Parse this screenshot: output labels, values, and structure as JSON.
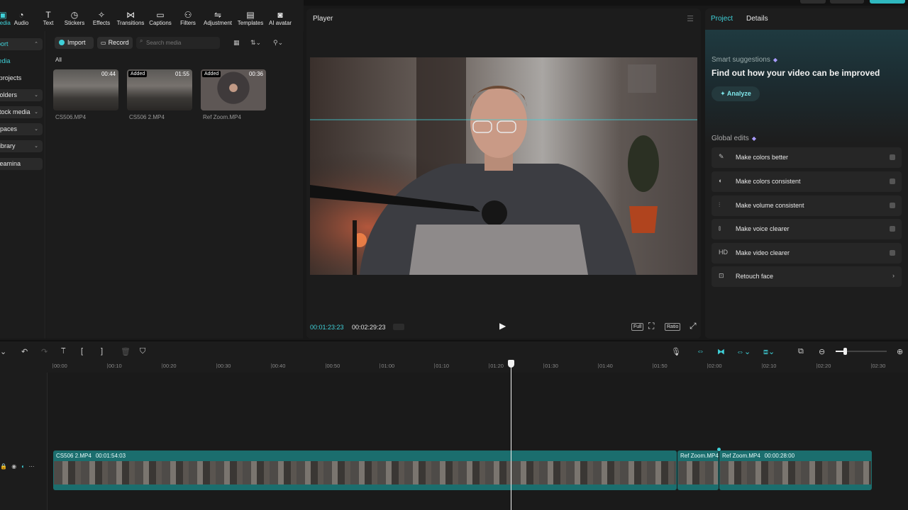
{
  "toolbar": {
    "items": [
      {
        "label": "Media",
        "icon": "media-icon",
        "glyph": "▣"
      },
      {
        "label": "Audio",
        "icon": "audio-icon",
        "glyph": "◔"
      },
      {
        "label": "Text",
        "icon": "text-icon",
        "glyph": "T"
      },
      {
        "label": "Stickers",
        "icon": "stickers-icon",
        "glyph": "◷"
      },
      {
        "label": "Effects",
        "icon": "effects-icon",
        "glyph": "✧"
      },
      {
        "label": "Transitions",
        "icon": "transitions-icon",
        "glyph": "⋈"
      },
      {
        "label": "Captions",
        "icon": "captions-icon",
        "glyph": "▭"
      },
      {
        "label": "Filters",
        "icon": "filters-icon",
        "glyph": "⚇"
      },
      {
        "label": "Adjustment",
        "icon": "adjustment-icon",
        "glyph": "⇋"
      },
      {
        "label": "Templates",
        "icon": "templates-icon",
        "glyph": "▤"
      },
      {
        "label": "AI avatar",
        "icon": "ai-avatar-icon",
        "glyph": "◙"
      }
    ]
  },
  "leftnav": {
    "items": [
      {
        "label": "Import",
        "chev": "⌃",
        "boxed": true,
        "active": true
      },
      {
        "label": "Media",
        "chev": "",
        "boxed": false,
        "active": true
      },
      {
        "label": "Your projects",
        "chev": "",
        "boxed": false,
        "active": false
      },
      {
        "label": "Folders",
        "chev": "⌄",
        "boxed": true,
        "active": false
      },
      {
        "label": "Stock media",
        "chev": "⌄",
        "boxed": true,
        "active": false
      },
      {
        "label": "Spaces",
        "chev": "⌄",
        "boxed": true,
        "active": false
      },
      {
        "label": "Library",
        "chev": "⌄",
        "boxed": true,
        "active": false
      },
      {
        "label": "Dreamina",
        "chev": "",
        "boxed": true,
        "active": false
      }
    ]
  },
  "media": {
    "import_label": "Import",
    "record_label": "Record",
    "search_placeholder": "Search media",
    "all_label": "All",
    "clips": [
      {
        "name": "CS506.MP4",
        "duration": "00:44",
        "added": ""
      },
      {
        "name": "CS506 2.MP4",
        "duration": "01:55",
        "added": "Added"
      },
      {
        "name": "Ref Zoom.MP4",
        "duration": "00:36",
        "added": "Added"
      }
    ]
  },
  "player": {
    "title": "Player",
    "current_time": "00:01:23:23",
    "total_time": "00:02:29:23",
    "full_label": "Full",
    "ratio_label": "Ratio"
  },
  "right_panel": {
    "tab_project": "Project",
    "tab_details": "Details",
    "smart_title": "Smart suggestions",
    "smart_headline": "Find out how your video can be improved",
    "analyze_label": "Analyze",
    "global_title": "Global edits",
    "global_items": [
      {
        "label": "Make colors better",
        "icon": "magic-wand-icon",
        "glyph": "✎",
        "kind": "toggle"
      },
      {
        "label": "Make colors consistent",
        "icon": "palette-icon",
        "glyph": "◐",
        "kind": "toggle"
      },
      {
        "label": "Make volume consistent",
        "icon": "sliders-icon",
        "glyph": "⫶",
        "kind": "toggle"
      },
      {
        "label": "Make voice clearer",
        "icon": "waveform-icon",
        "glyph": "⫾",
        "kind": "toggle"
      },
      {
        "label": "Make video clearer",
        "icon": "hd-icon",
        "glyph": "HD",
        "kind": "toggle"
      },
      {
        "label": "Retouch face",
        "icon": "retouch-icon",
        "glyph": "⊡",
        "kind": "chevron"
      }
    ]
  },
  "timeline": {
    "ruler_labels": [
      "00:00",
      "00:10",
      "00:20",
      "00:30",
      "00:40",
      "00:50",
      "01:00",
      "01:10",
      "01:20",
      "01:30",
      "01:40",
      "01:50",
      "02:00",
      "02:10",
      "02:20",
      "02:30"
    ],
    "clips": [
      {
        "name": "CS506 2.MP4",
        "duration": "00:01:54:03"
      },
      {
        "name": "Ref Zoom.MP4",
        "duration": ""
      },
      {
        "name": "Ref Zoom.MP4",
        "duration": "00:00:28:00"
      }
    ]
  },
  "colors": {
    "accent": "#3fd0d8",
    "clip": "#1b6e6e",
    "panel": "#1c1c1c"
  }
}
